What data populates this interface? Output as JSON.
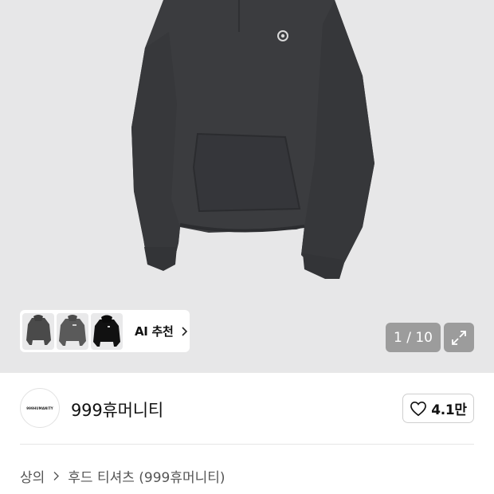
{
  "gallery": {
    "product_image_icon": "hoodie-image",
    "ai_recommend": {
      "label": "AI 추천",
      "thumbnails": [
        {
          "name": "gray-hoodie-thumb",
          "color": "#4a4a4a"
        },
        {
          "name": "charcoal-hoodie-thumb",
          "color": "#5a5a5a"
        },
        {
          "name": "black-hoodie-thumb",
          "color": "#111111"
        }
      ]
    },
    "counter": "1 / 10",
    "expand_icon": "expand-icon"
  },
  "brand": {
    "logo_text": "999HUMANITY",
    "name": "999휴머니티"
  },
  "like": {
    "icon": "heart-icon",
    "count": "4.1만"
  },
  "breadcrumb": {
    "category": "상의",
    "subcategory": "후드 티셔츠 (999휴머니티)"
  },
  "colors": {
    "hero_bg": "#e7e7e8",
    "garment": "#3b3c3f",
    "overlay": "#6e6e6e"
  }
}
